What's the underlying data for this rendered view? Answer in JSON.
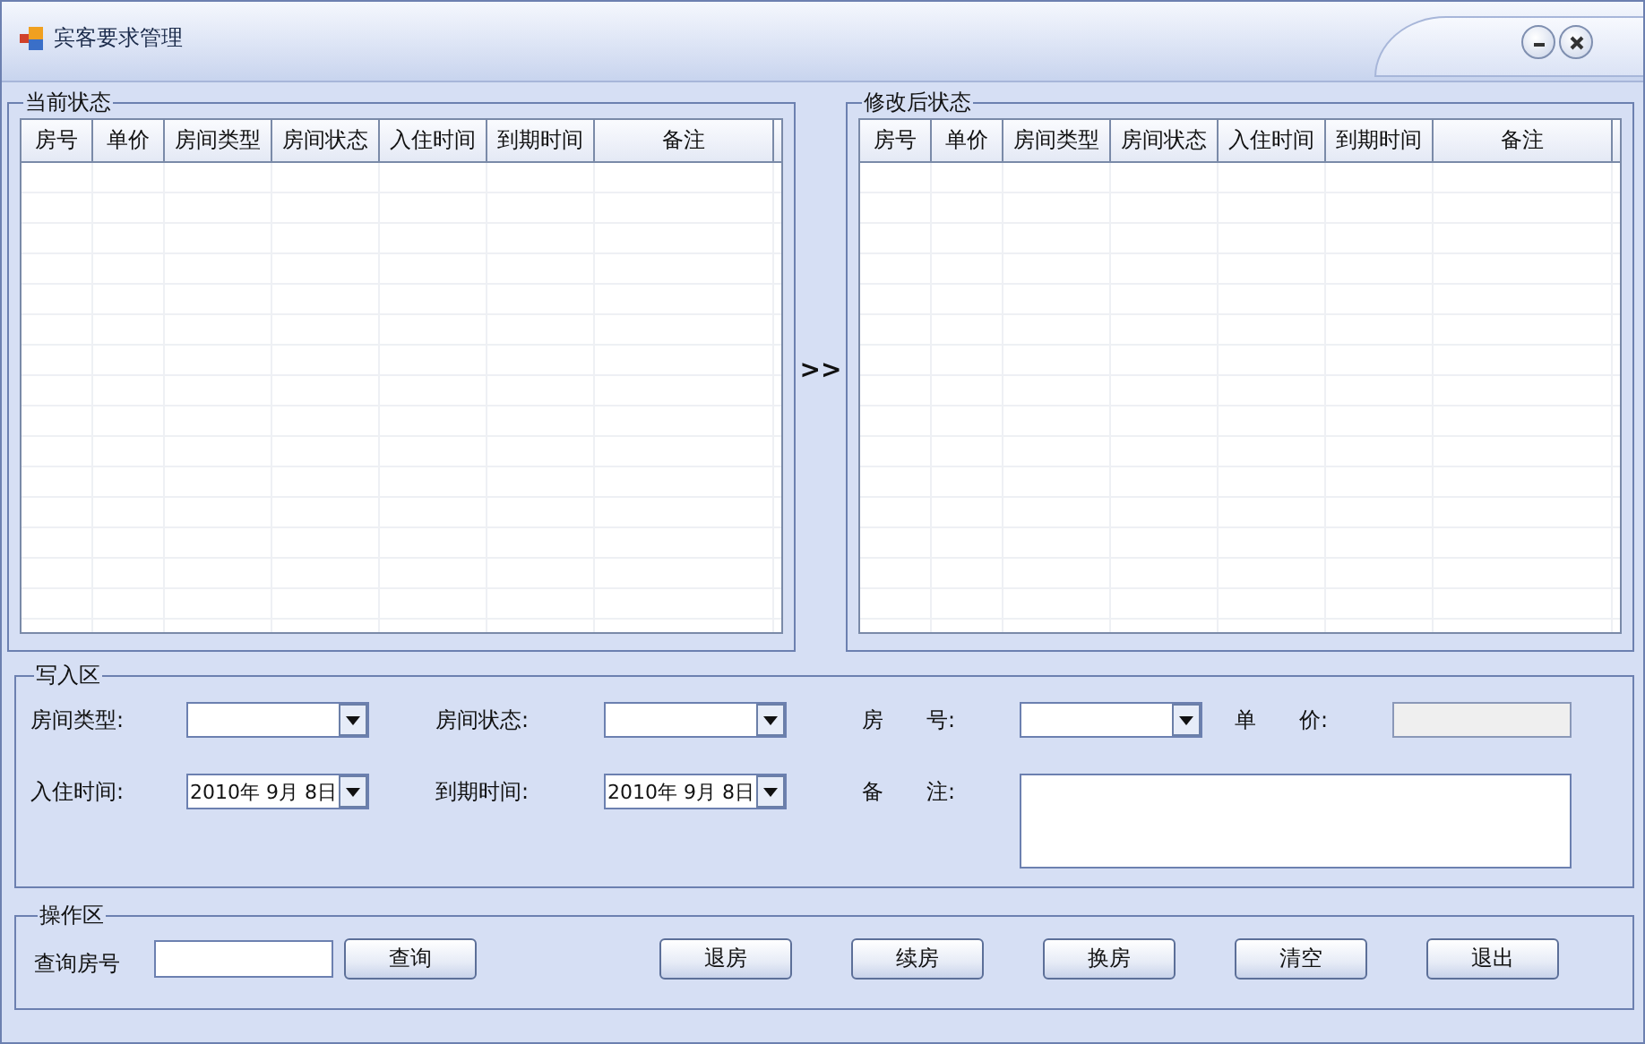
{
  "window": {
    "title": "宾客要求管理"
  },
  "current_state": {
    "title": "当前状态",
    "columns": [
      "房号",
      "单价",
      "房间类型",
      "房间状态",
      "入住时间",
      "到期时间",
      "备注"
    ]
  },
  "transfer": {
    "label": ">>"
  },
  "modified_state": {
    "title": "修改后状态",
    "columns": [
      "房号",
      "单价",
      "房间类型",
      "房间状态",
      "入住时间",
      "到期时间",
      "备注"
    ]
  },
  "write_area": {
    "title": "写入区",
    "fields": [
      {
        "label": "房间类型:",
        "kind": "combo"
      },
      {
        "label": "房间状态:",
        "kind": "combo"
      },
      {
        "label": "房　　号:",
        "kind": "combo"
      },
      {
        "label": "单　　价:",
        "kind": "readonly"
      },
      {
        "label": "入住时间:",
        "kind": "date",
        "value": "2010年 9月 8日"
      },
      {
        "label": "到期时间:",
        "kind": "date",
        "value": "2010年 9月 8日"
      },
      {
        "label": "备　　注:",
        "kind": "memo"
      }
    ]
  },
  "operation_area": {
    "title": "操作区",
    "query_label": "查询房号",
    "buttons": [
      {
        "label": "查询",
        "kind": "query"
      },
      {
        "label": "退房",
        "kind": "action"
      },
      {
        "label": "续房",
        "kind": "action"
      },
      {
        "label": "换房",
        "kind": "action"
      },
      {
        "label": "清空",
        "kind": "action"
      },
      {
        "label": "退出",
        "kind": "action"
      }
    ]
  }
}
